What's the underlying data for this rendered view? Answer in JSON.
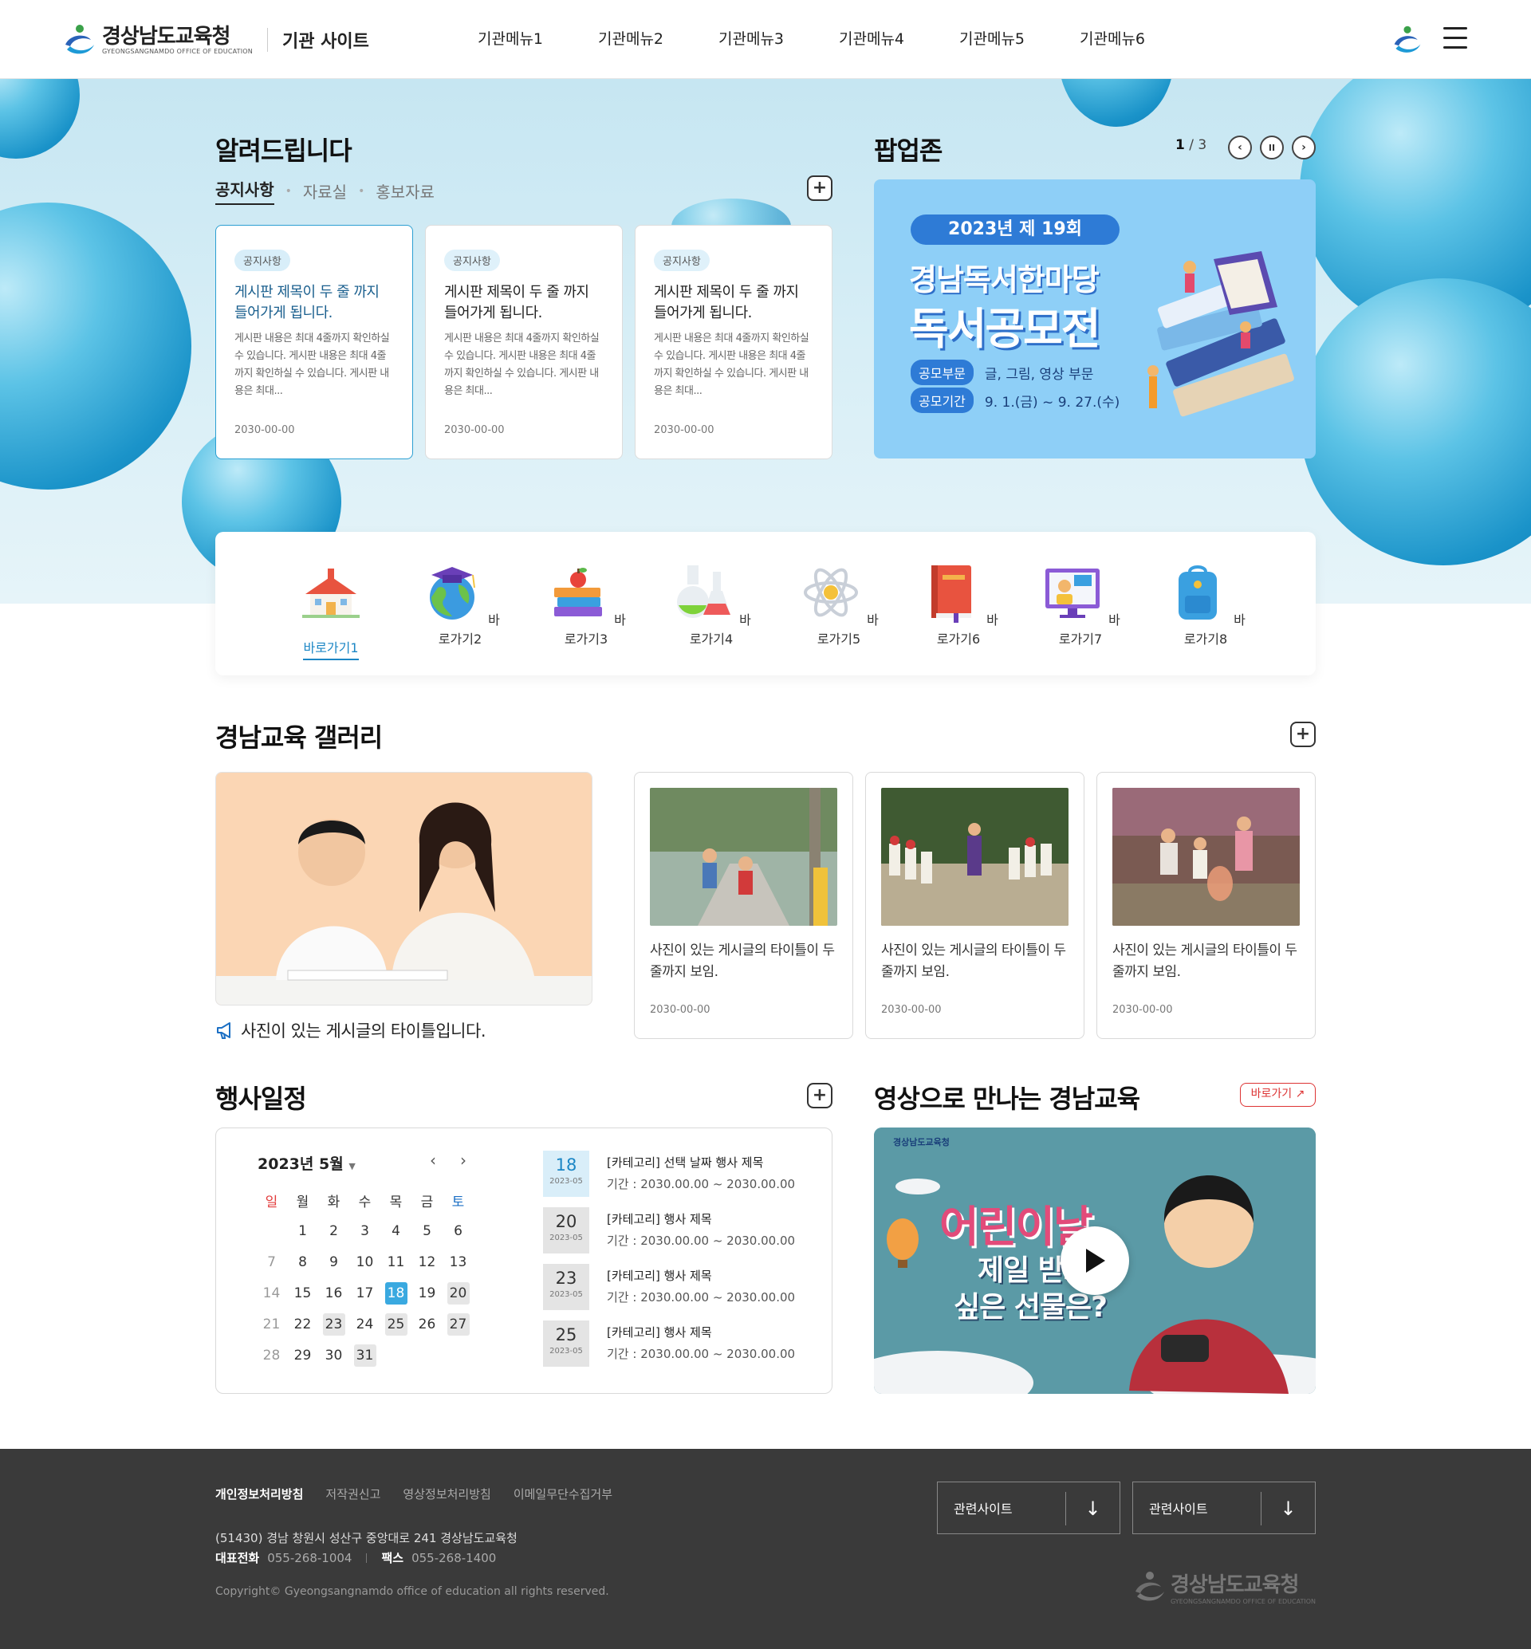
{
  "header": {
    "logo_ko": "경상남도교육청",
    "logo_en": "GYEONGSANGNAMDO OFFICE OF EDUCATION",
    "site_name": "기관 사이트",
    "menu": [
      "기관메뉴1",
      "기관메뉴2",
      "기관메뉴3",
      "기관메뉴4",
      "기관메뉴5",
      "기관메뉴6"
    ]
  },
  "notice": {
    "title": "알려드립니다",
    "tabs": [
      "공지사항",
      "자료실",
      "홍보자료"
    ],
    "cards": [
      {
        "badge": "공지사항",
        "title": "게시판 제목이 두 줄 까지 들어가게 됩니다.",
        "body": "게시판 내용은 최대 4줄까지 확인하실 수 있습니다. 게시판 내용은 최대 4줄까지 확인하실 수 있습니다. 게시판 내용은 최대...",
        "date": "2030-00-00"
      },
      {
        "badge": "공지사항",
        "title": "게시판 제목이 두 줄 까지 들어가게 됩니다.",
        "body": "게시판 내용은 최대 4줄까지 확인하실 수 있습니다. 게시판 내용은 최대 4줄까지 확인하실 수 있습니다. 게시판 내용은 최대...",
        "date": "2030-00-00"
      },
      {
        "badge": "공지사항",
        "title": "게시판 제목이 두 줄 까지 들어가게 됩니다.",
        "body": "게시판 내용은 최대 4줄까지 확인하실 수 있습니다. 게시판 내용은 최대 4줄까지 확인하실 수 있습니다. 게시판 내용은 최대...",
        "date": "2030-00-00"
      }
    ]
  },
  "popup": {
    "title": "팝업존",
    "current": "1",
    "sep": "/",
    "total": "3",
    "banner": {
      "year": "2023년 제 19회",
      "line1": "경남독서한마당",
      "line2": "독서공모전",
      "tag1": "공모부문",
      "val1": "글, 그림, 영상 부문",
      "tag2": "공모기간",
      "val2": "9. 1.(금) ~ 9. 27.(수)"
    }
  },
  "quick": {
    "items": [
      "바로가기1",
      "바로가기2",
      "바로가기3",
      "바로가기4",
      "바로가기5",
      "바로가기6",
      "바로가기7",
      "바로가기8"
    ]
  },
  "gallery": {
    "title": "경남교육 갤러리",
    "feature_caption": "사진이 있는 게시글의 타이틀입니다.",
    "cards": [
      {
        "title": "사진이 있는 게시글의 타이틀이 두 줄까지 보임.",
        "date": "2030-00-00"
      },
      {
        "title": "사진이 있는 게시글의 타이틀이 두 줄까지 보임.",
        "date": "2030-00-00"
      },
      {
        "title": "사진이 있는 게시글의 타이틀이 두 줄까지 보임.",
        "date": "2030-00-00"
      }
    ]
  },
  "events": {
    "title": "행사일정",
    "month": "2023년 5월",
    "weekdays": [
      "일",
      "월",
      "화",
      "수",
      "목",
      "금",
      "토"
    ],
    "list": [
      {
        "day": "18",
        "ym": "2023-05",
        "title": "[카테고리] 선택 날짜 행사 제목",
        "period": "기간 : 2030.00.00 ~ 2030.00.00"
      },
      {
        "day": "20",
        "ym": "2023-05",
        "title": "[카테고리] 행사 제목",
        "period": "기간 : 2030.00.00 ~ 2030.00.00"
      },
      {
        "day": "23",
        "ym": "2023-05",
        "title": "[카테고리] 행사 제목",
        "period": "기간 : 2030.00.00 ~ 2030.00.00"
      },
      {
        "day": "25",
        "ym": "2023-05",
        "title": "[카테고리] 행사 제목",
        "period": "기간 : 2030.00.00 ~ 2030.00.00"
      }
    ]
  },
  "video": {
    "title": "영상으로 만나는 경남교육",
    "link": "바로가기 ↗",
    "thumb_logo": "경상남도교육청",
    "thumb_line1": "어린이날",
    "thumb_line2": "제일 받고",
    "thumb_line3": "싶은 선물은?"
  },
  "footer": {
    "links": [
      "개인정보처리방침",
      "저작권신고",
      "영상정보처리방침",
      "이메일무단수집거부"
    ],
    "address": "(51430) 경남 창원시 성산구 중앙대로 241 경상남도교육청",
    "tel_label": "대표전화",
    "tel": "055-268-1004",
    "fax_label": "팩스",
    "fax": "055-268-1400",
    "copyright": "Copyright© Gyeongsangnamdo office of education all rights reserved.",
    "related1": "관련사이트",
    "related2": "관련사이트",
    "logo_ko": "경상남도교육청",
    "logo_en": "GYEONGSANGNAMDO OFFICE OF EDUCATION"
  }
}
